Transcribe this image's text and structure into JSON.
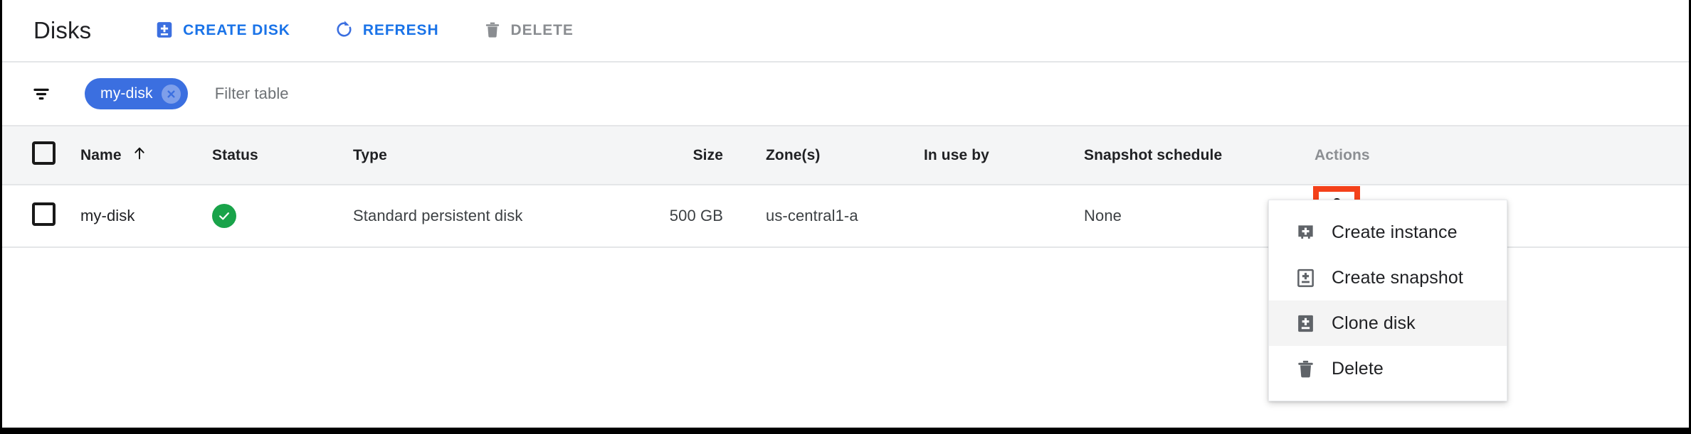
{
  "header": {
    "title": "Disks",
    "buttons": [
      {
        "label": "CREATE DISK",
        "icon": "create-disk-icon",
        "disabled": false
      },
      {
        "label": "REFRESH",
        "icon": "refresh-icon",
        "disabled": false
      },
      {
        "label": "DELETE",
        "icon": "trash-icon",
        "disabled": true
      }
    ]
  },
  "filter": {
    "icon": "filter-list-icon",
    "chips": [
      {
        "label": "my-disk",
        "remove_icon": "close-circle-icon"
      }
    ],
    "placeholder": "Filter table"
  },
  "table": {
    "select_all_checkbox": false,
    "sort_column": "Name",
    "sort_direction": "ascending",
    "sort_icon": "arrow-up-icon",
    "columns": [
      "Name",
      "Status",
      "Type",
      "Size",
      "Zone(s)",
      "In use by",
      "Snapshot schedule",
      "Actions"
    ],
    "rows": [
      {
        "selected": false,
        "name": "my-disk",
        "status": "ok",
        "status_icon": "check-circle-icon",
        "type": "Standard persistent disk",
        "size": "500 GB",
        "zone": "us-central1-a",
        "in_use_by": "",
        "snapshot_schedule": "None",
        "actions_icon": "more-vert-icon"
      }
    ]
  },
  "context_menu": {
    "open": true,
    "items": [
      {
        "label": "Create instance",
        "icon": "vm-instance-add-icon",
        "hover": false
      },
      {
        "label": "Create snapshot",
        "icon": "snapshot-add-icon",
        "hover": false
      },
      {
        "label": "Clone disk",
        "icon": "disk-add-icon",
        "hover": true
      },
      {
        "label": "Delete",
        "icon": "trash-icon",
        "hover": false
      }
    ]
  },
  "colors": {
    "accent_blue": "#1a73e8",
    "chip_blue": "#3b6fe0",
    "status_green": "#19a34a",
    "highlight_orange": "#f4411a",
    "header_grey": "#f4f5f6",
    "disabled_grey": "#8a8d91"
  }
}
